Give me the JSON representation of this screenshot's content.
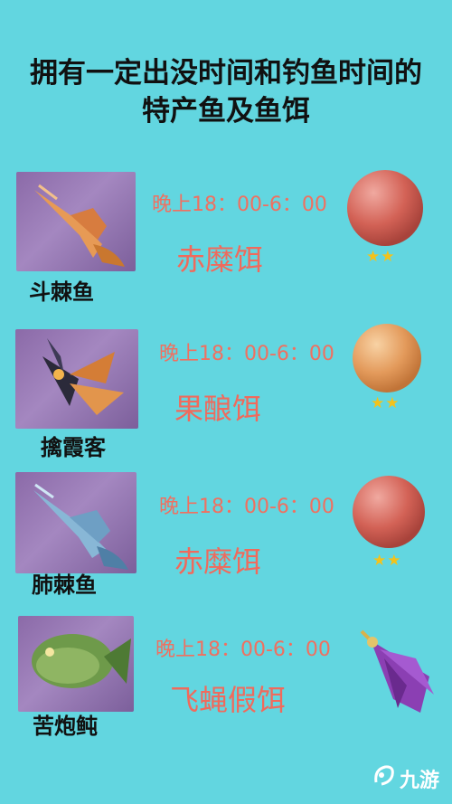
{
  "title": {
    "line1": "拥有一定出没时间和钓鱼时间的",
    "line2": "特产鱼及鱼饵"
  },
  "entries": [
    {
      "fish": "斗棘鱼",
      "time": "晚上18：00-6：00",
      "bait": "赤糜饵",
      "stars": "★★"
    },
    {
      "fish": "擒霞客",
      "time": "晚上18：00-6：00",
      "bait": "果酿饵",
      "stars": "★★"
    },
    {
      "fish": "肺棘鱼",
      "time": "晚上18：00-6：00",
      "bait": "赤糜饵",
      "stars": "★★"
    },
    {
      "fish": "苦炮鲀",
      "time": "晚上18：00-6：00",
      "bait": "飞蝇假饵",
      "stars": ""
    }
  ],
  "watermark": {
    "text": "九游",
    "icon": "jiuyou-logo-icon"
  },
  "colors": {
    "background": "#62d6e0",
    "accent_text": "#f06a5c",
    "star": "#f4c21a"
  }
}
